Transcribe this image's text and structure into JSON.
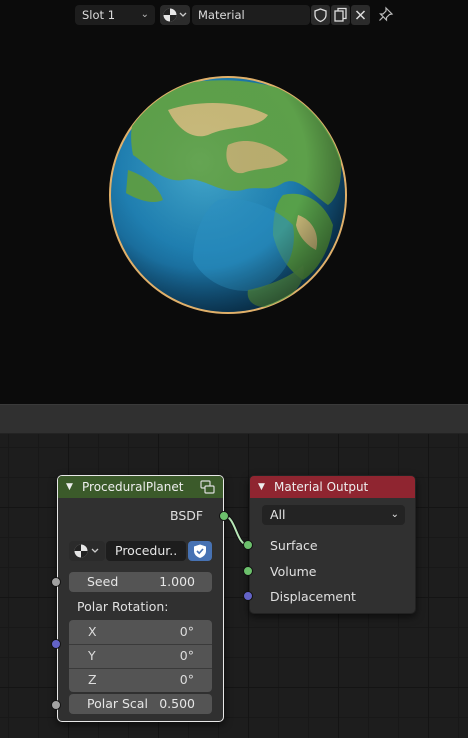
{
  "header": {
    "slot_label": "Slot 1",
    "material_name": "Material"
  },
  "nodes": {
    "procedural_planet": {
      "title": "ProceduralPlanet",
      "output_socket_label": "BSDF",
      "datablock_name": "Procedur..",
      "seed_label": "Seed",
      "seed_value": "1.000",
      "polar_rotation_label": "Polar Rotation:",
      "x_label": "X",
      "x_value": "0°",
      "y_label": "Y",
      "y_value": "0°",
      "z_label": "Z",
      "z_value": "0°",
      "polar_scale_label": "Polar Scal",
      "polar_scale_value": "0.500",
      "header_color": "#3b5a2a"
    },
    "material_output": {
      "title": "Material Output",
      "target": "All",
      "surface_label": "Surface",
      "volume_label": "Volume",
      "displacement_label": "Displacement",
      "header_color": "#8f2530"
    }
  },
  "colors": {
    "socket_shader": "#6cc06c",
    "socket_float": "#a1a1a1",
    "socket_vector": "#6363c7"
  }
}
